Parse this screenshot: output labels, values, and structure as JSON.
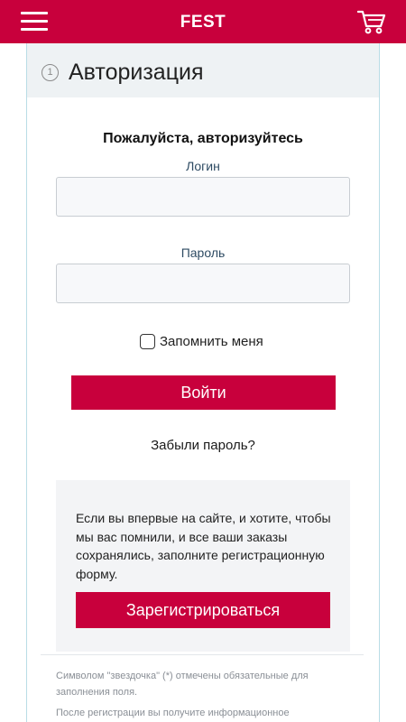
{
  "header": {
    "brand": "FEST",
    "menu_icon": "hamburger-menu-icon",
    "cart_icon": "shopping-cart-icon",
    "accent_color": "#c8003c"
  },
  "card": {
    "step_number": "1",
    "title": "Авторизация"
  },
  "form": {
    "subtitle": "Пожалуйста, авторизуйтесь",
    "login_label": "Логин",
    "login_value": "",
    "password_label": "Пароль",
    "password_value": "",
    "remember_label": "Запомнить меня",
    "remember_checked": false,
    "login_button": "Войти",
    "forgot_link": "Забыли пароль?"
  },
  "registration": {
    "text": "Если вы впервые на сайте, и хотите, чтобы мы вас помнили, и все ваши заказы сохранялись, заполните регистрационную форму.",
    "button": "Зарегистрироваться"
  },
  "notes": {
    "required_note": "Символом \"звездочка\" (*) отмечены обязательные для заполнения поля.",
    "after_registration": "После регистрации вы получите информационное"
  }
}
